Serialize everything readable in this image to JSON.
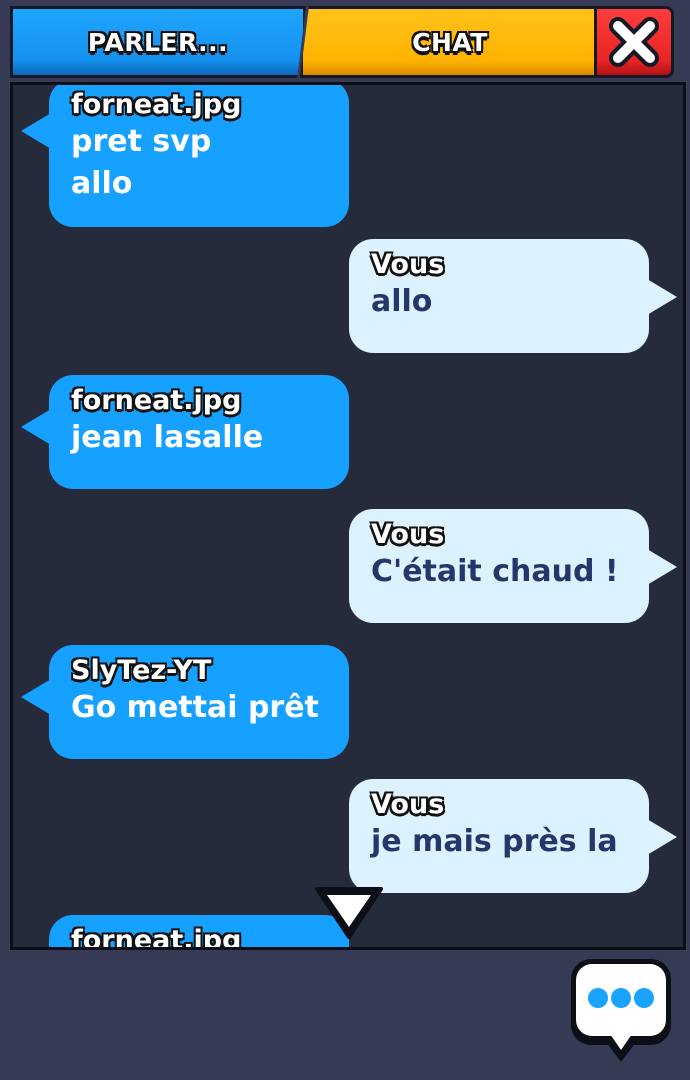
{
  "tabs": {
    "speak_label": "PARLER...",
    "chat_label": "CHAT",
    "close_icon": "close-x-icon"
  },
  "colors": {
    "speak_tab": "#1591ee",
    "chat_tab": "#ffb300",
    "close_button": "#e82424",
    "panel_bg": "#262b3b",
    "other_bubble": "#16a0ff",
    "own_bubble": "#dcf2ff",
    "own_text": "#25366a"
  },
  "messages": [
    {
      "sender": "forneat.jpg",
      "lines": [
        "pret svp",
        "allo"
      ],
      "own": false
    },
    {
      "sender": "Vous",
      "lines": [
        "allo"
      ],
      "own": true
    },
    {
      "sender": "forneat.jpg",
      "lines": [
        "jean lasalle"
      ],
      "own": false
    },
    {
      "sender": "Vous",
      "lines": [
        "C'était chaud !"
      ],
      "own": true
    },
    {
      "sender": "SlyTez-YT",
      "lines": [
        "Go mettai prêt"
      ],
      "own": false
    },
    {
      "sender": "Vous",
      "lines": [
        "je mais près la"
      ],
      "own": true
    },
    {
      "sender": "forneat.jpg",
      "lines": [],
      "own": false
    }
  ],
  "icons": {
    "scroll_down": "down-triangle-icon",
    "chat_button": "speech-bubble-dots-icon"
  }
}
